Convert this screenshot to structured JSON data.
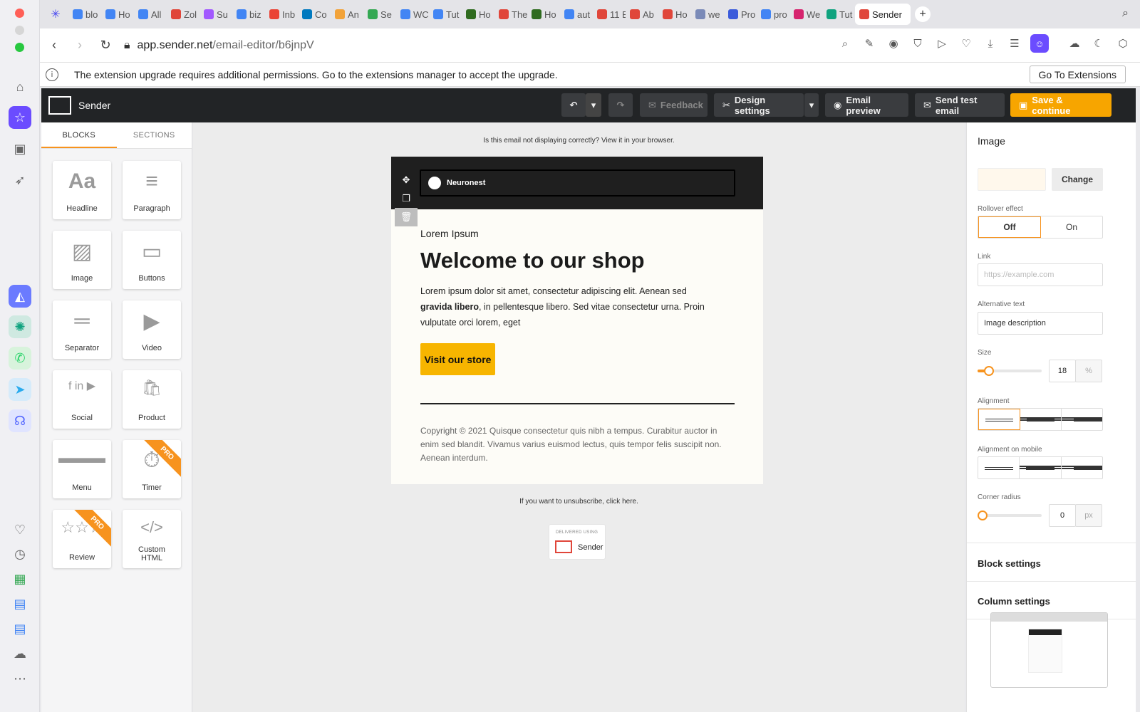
{
  "browser": {
    "tabs": [
      {
        "label": "blo",
        "color": "#4285f4"
      },
      {
        "label": "Ho",
        "color": "#4285f4"
      },
      {
        "label": "All",
        "color": "#4285f4"
      },
      {
        "label": "Zol",
        "color": "#e0463a"
      },
      {
        "label": "Su",
        "color": "#a259ff"
      },
      {
        "label": "biz",
        "color": "#4285f4"
      },
      {
        "label": "Inb",
        "color": "#ea4335"
      },
      {
        "label": "Co",
        "color": "#0079bf"
      },
      {
        "label": "An",
        "color": "#f2a33a"
      },
      {
        "label": "Se",
        "color": "#34a853"
      },
      {
        "label": "WC",
        "color": "#4285f4"
      },
      {
        "label": "Tut",
        "color": "#4285f4"
      },
      {
        "label": "Ho",
        "color": "#2f6b1f"
      },
      {
        "label": "The",
        "color": "#e0463a"
      },
      {
        "label": "Ho",
        "color": "#2f6b1f"
      },
      {
        "label": "aut",
        "color": "#4285f4"
      },
      {
        "label": "11 E",
        "color": "#e0463a"
      },
      {
        "label": "Ab",
        "color": "#e0463a"
      },
      {
        "label": "Ho",
        "color": "#e0463a"
      },
      {
        "label": "we",
        "color": "#7a8ab8"
      },
      {
        "label": "Pro",
        "color": "#3b5bdb"
      },
      {
        "label": "pro",
        "color": "#4285f4"
      },
      {
        "label": "We",
        "color": "#d6246e"
      },
      {
        "label": "Tut",
        "color": "#10a37f"
      },
      {
        "label": "Sender",
        "color": "#e0463a",
        "active": true
      }
    ],
    "url_host": "app.sender.net",
    "url_path": "/email-editor/b6jnpV",
    "notice": "The extension upgrade requires additional permissions. Go to the extensions manager to accept the upgrade.",
    "notice_button": "Go To Extensions"
  },
  "app": {
    "brand": "Sender",
    "feedback": "Feedback",
    "design_settings": "Design settings",
    "email_preview": "Email preview",
    "send_test": "Send test email",
    "save": "Save & continue"
  },
  "blocks_panel": {
    "tabs": [
      "BLOCKS",
      "SECTIONS"
    ],
    "pro_badge": "PRO",
    "items": [
      {
        "label": "Headline",
        "icon": "Aa"
      },
      {
        "label": "Paragraph",
        "icon": "≡"
      },
      {
        "label": "Image",
        "icon": "▨"
      },
      {
        "label": "Buttons",
        "icon": "▭"
      },
      {
        "label": "Separator",
        "icon": "═"
      },
      {
        "label": "Video",
        "icon": "▶"
      },
      {
        "label": "Social",
        "icon": "f in ▶"
      },
      {
        "label": "Product",
        "icon": "🛍"
      },
      {
        "label": "Menu",
        "icon": "▬▬▬"
      },
      {
        "label": "Timer",
        "icon": "⏱",
        "pro": true
      },
      {
        "label": "Review",
        "icon": "☆☆☆",
        "pro": true
      },
      {
        "label": "Custom HTML",
        "icon": "</>"
      }
    ]
  },
  "email": {
    "browser_line": "Is this email not displaying correctly? View it in your browser.",
    "header_name": "Neuronest",
    "subtitle": "Lorem Ipsum",
    "title": "Welcome to our shop",
    "body_1": "Lorem ipsum dolor sit amet, consectetur adipiscing elit. Aenean sed ",
    "body_bold": "gravida libero",
    "body_2": ", in pellentesque libero. Sed vitae consectetur urna. Proin vulputate orci lorem, eget",
    "button": "Visit our store",
    "copyright": "Copyright © 2021 Quisque consectetur quis nibh a tempus. Curabitur auctor in enim sed blandit. Vivamus varius euismod lectus, quis tempor felis suscipit non. Aenean interdum.",
    "unsubscribe": "If you want to unsubscribe, click here.",
    "delivered_label": "DELIVERED USING",
    "delivered_brand": "Sender"
  },
  "settings": {
    "title": "Image",
    "change": "Change",
    "rollover_label": "Rollover effect",
    "rollover_off": "Off",
    "rollover_on": "On",
    "link_label": "Link",
    "link_placeholder": "https://example.com",
    "alt_label": "Alternative text",
    "alt_value": "Image description",
    "size_label": "Size",
    "size_value": "18",
    "size_unit": "%",
    "size_fraction": 0.18,
    "alignment_label": "Alignment",
    "alignment_mobile_label": "Alignment on mobile",
    "corner_label": "Corner radius",
    "corner_value": "0",
    "corner_unit": "px",
    "corner_fraction": 0,
    "block_settings": "Block settings",
    "column_settings": "Column settings"
  }
}
